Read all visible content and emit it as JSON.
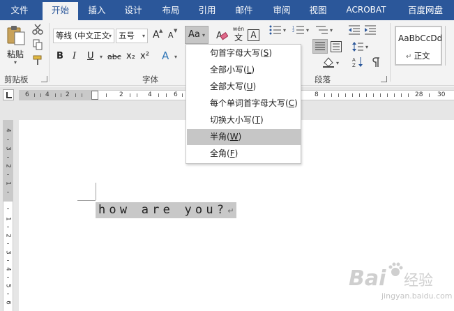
{
  "tabs": [
    {
      "label": "文件",
      "active": false
    },
    {
      "label": "开始",
      "active": true
    },
    {
      "label": "插入",
      "active": false
    },
    {
      "label": "设计",
      "active": false
    },
    {
      "label": "布局",
      "active": false
    },
    {
      "label": "引用",
      "active": false
    },
    {
      "label": "邮件",
      "active": false
    },
    {
      "label": "审阅",
      "active": false
    },
    {
      "label": "视图",
      "active": false
    },
    {
      "label": "ACROBAT",
      "active": false
    },
    {
      "label": "百度网盘",
      "active": false
    }
  ],
  "clipboard": {
    "paste_label": "粘贴",
    "group_label": "剪贴板"
  },
  "font": {
    "name_value": "等线 (中文正文",
    "size_value": "五号",
    "grow_label": "A",
    "shrink_label": "A",
    "case_label": "Aa",
    "phonetic_top": "wén",
    "phonetic_bottom": "文",
    "border_label": "A",
    "bold_label": "B",
    "italic_label": "I",
    "underline_label": "U",
    "strike_label": "abc",
    "subscript_label": "x₂",
    "superscript_label": "x²",
    "effects_label": "A",
    "group_label": "字体"
  },
  "paragraph": {
    "group_label": "段落"
  },
  "styles": {
    "sample_text": "AaBbCcDd",
    "style_name": "正文"
  },
  "case_menu": {
    "items": [
      {
        "label": "句首字母大写",
        "accel": "S",
        "highlighted": false
      },
      {
        "label": "全部小写",
        "accel": "L",
        "highlighted": false
      },
      {
        "label": "全部大写",
        "accel": "U",
        "highlighted": false
      },
      {
        "label": "每个单词首字母大写",
        "accel": "C",
        "highlighted": false
      },
      {
        "label": "切换大小写",
        "accel": "T",
        "highlighted": false
      },
      {
        "label": "半角",
        "accel": "W",
        "highlighted": true
      },
      {
        "label": "全角",
        "accel": "F",
        "highlighted": false
      }
    ]
  },
  "ruler": {
    "h_numbers": [
      "6",
      "4",
      "2",
      "2",
      "4",
      "6",
      "8",
      "28",
      "30"
    ],
    "v_numbers": [
      "4",
      "3",
      "2",
      "1",
      "1",
      "2",
      "3",
      "4",
      "5",
      "6"
    ]
  },
  "document": {
    "text": "how are you?",
    "paragraph_mark": "↵"
  },
  "watermark": {
    "brand": "Bai",
    "brand_cn": "经验",
    "url": "jingyan.baidu.com"
  },
  "colors": {
    "accent": "#2b579a",
    "ribbon_bg": "#f3f3f3",
    "highlight": "#c8c8c8"
  }
}
